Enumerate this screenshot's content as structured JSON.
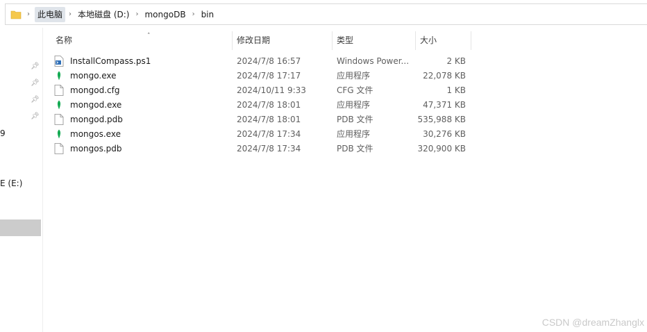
{
  "breadcrumb": {
    "items": [
      "此电脑",
      "本地磁盘 (D:)",
      "mongoDB",
      "bin"
    ]
  },
  "nav": {
    "cut_item_1": "9",
    "cut_item_2": "E (E:)"
  },
  "columns": {
    "name": "名称",
    "date": "修改日期",
    "type": "类型",
    "size": "大小"
  },
  "files": [
    {
      "name": "InstallCompass.ps1",
      "date": "2024/7/8 16:57",
      "type": "Windows Power...",
      "size": "2 KB",
      "icon": "powershell-script-icon"
    },
    {
      "name": "mongo.exe",
      "date": "2024/7/8 17:17",
      "type": "应用程序",
      "size": "22,078 KB",
      "icon": "mongodb-leaf-icon"
    },
    {
      "name": "mongod.cfg",
      "date": "2024/10/11 9:33",
      "type": "CFG 文件",
      "size": "1 KB",
      "icon": "blank-file-icon"
    },
    {
      "name": "mongod.exe",
      "date": "2024/7/8 18:01",
      "type": "应用程序",
      "size": "47,371 KB",
      "icon": "mongodb-leaf-icon"
    },
    {
      "name": "mongod.pdb",
      "date": "2024/7/8 18:01",
      "type": "PDB 文件",
      "size": "535,988 KB",
      "icon": "blank-file-icon"
    },
    {
      "name": "mongos.exe",
      "date": "2024/7/8 17:34",
      "type": "应用程序",
      "size": "30,276 KB",
      "icon": "mongodb-leaf-icon"
    },
    {
      "name": "mongos.pdb",
      "date": "2024/7/8 17:34",
      "type": "PDB 文件",
      "size": "320,900 KB",
      "icon": "blank-file-icon"
    }
  ],
  "watermark": "CSDN @dreamZhanglx",
  "colors": {
    "folder": "#f5c84c",
    "mongodb_leaf": "#13aa52",
    "selection": "#cccccc"
  }
}
